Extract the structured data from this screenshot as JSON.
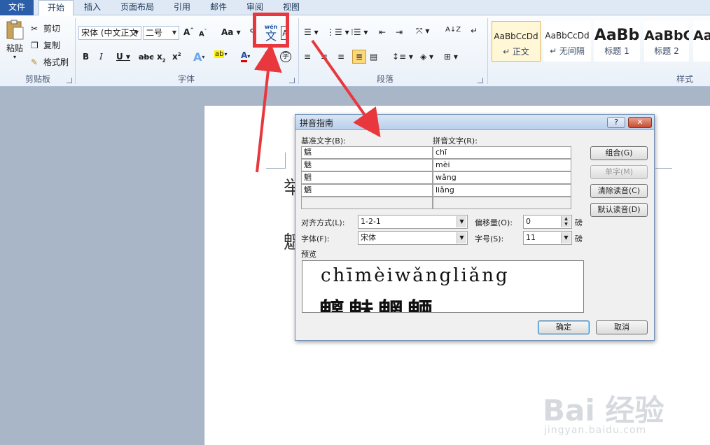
{
  "tabs": [
    {
      "label": "文件"
    },
    {
      "label": "开始"
    },
    {
      "label": "插入"
    },
    {
      "label": "页面布局"
    },
    {
      "label": "引用"
    },
    {
      "label": "邮件"
    },
    {
      "label": "审阅"
    },
    {
      "label": "视图"
    }
  ],
  "clipboard": {
    "paste": "粘贴",
    "cut": "剪切",
    "copy": "复制",
    "format_painter": "格式刷",
    "group": "剪贴板"
  },
  "font": {
    "name": "宋体 (中文正文",
    "size": "二号",
    "group": "字体",
    "phonetic_guide_icon": "wén 文"
  },
  "paragraph": {
    "group": "段落"
  },
  "styles": {
    "group": "样式",
    "items": [
      {
        "sample": "AaBbCcDd",
        "name": "↵ 正文"
      },
      {
        "sample": "AaBbCcDd",
        "name": "↵ 无间隔"
      },
      {
        "sample": "AaBb",
        "name": "标题 1"
      },
      {
        "sample": "AaBbC",
        "name": "标题 2"
      },
      {
        "sample": "Aa",
        "name": ""
      }
    ]
  },
  "document": {
    "line1_partial": "举",
    "line2_partial": "魑"
  },
  "dialog": {
    "title": "拼音指南",
    "help": "?",
    "close": "✕",
    "base_label": "基准文字(B):",
    "ruby_label": "拼音文字(R):",
    "rows": [
      {
        "base": "魑",
        "ruby": "chī"
      },
      {
        "base": "魅",
        "ruby": "mèi"
      },
      {
        "base": "魍",
        "ruby": "wǎng"
      },
      {
        "base": "魉",
        "ruby": "liǎng"
      },
      {
        "base": "",
        "ruby": ""
      }
    ],
    "buttons": {
      "group": "组合(G)",
      "mono": "单字(M)",
      "clear": "清除读音(C)",
      "default": "默认读音(D)",
      "ok": "确定",
      "cancel": "取消"
    },
    "alignment_label": "对齐方式(L):",
    "alignment_value": "1-2-1",
    "offset_label": "偏移量(O):",
    "offset_value": "0",
    "offset_unit": "磅",
    "font_label": "字体(F):",
    "font_value": "宋体",
    "size_label": "字号(S):",
    "size_value": "11",
    "size_unit": "磅",
    "preview_label": "预览",
    "preview_pinyin": "chīmèiwǎngliǎng",
    "preview_chars": "魑魅魍魉"
  },
  "watermark": {
    "big": "Bai 经验",
    "small": "jingyan.baidu.com"
  },
  "colors": {
    "annotation": "#e8383d",
    "file_tab": "#2a5ea8",
    "workspace": "#a9b6c8"
  }
}
